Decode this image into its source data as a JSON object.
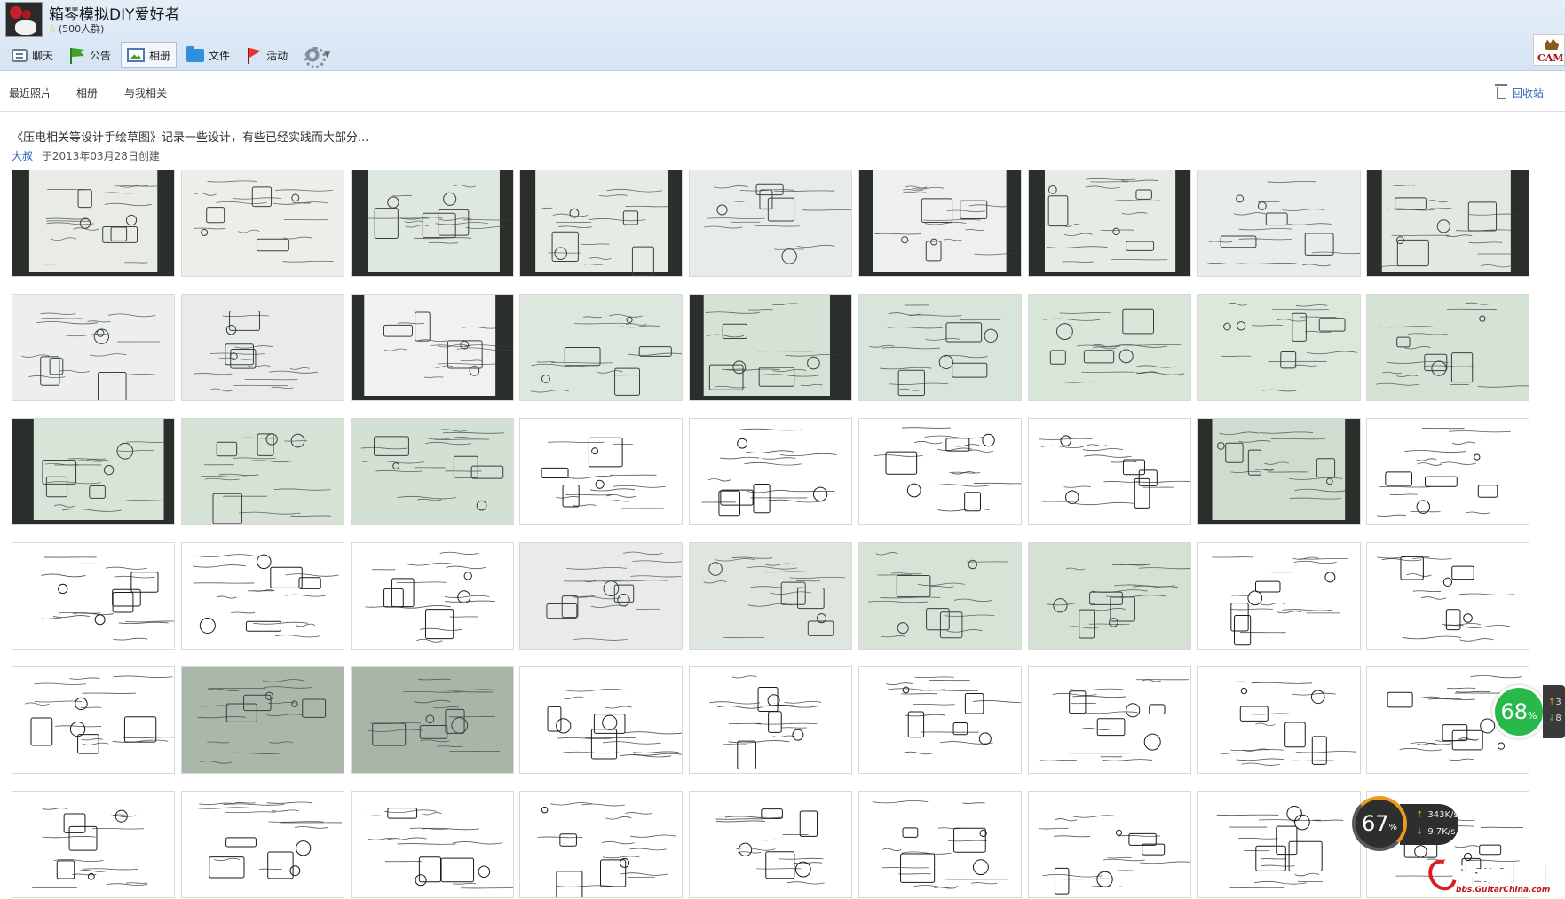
{
  "header": {
    "group_name": "箱琴模拟DIY爱好者",
    "member_count": "(500人群)",
    "toolbar": [
      {
        "id": "chat",
        "label": "聊天",
        "icon": "chat-icon"
      },
      {
        "id": "notice",
        "label": "公告",
        "icon": "flag-icon"
      },
      {
        "id": "album",
        "label": "相册",
        "icon": "album-icon",
        "active": true
      },
      {
        "id": "file",
        "label": "文件",
        "icon": "folder-icon"
      },
      {
        "id": "activity",
        "label": "活动",
        "icon": "red-flag-icon"
      }
    ],
    "brand_logo_text": "CAMI"
  },
  "subnav": {
    "tabs": [
      "最近照片",
      "相册",
      "与我相关"
    ],
    "recycle_bin": "回收站"
  },
  "album": {
    "title": "《压电相关等设计手绘草图》记录一些设计，有些已经实践而大部分...",
    "author": "大叔",
    "created": "于2013年03月28日创建"
  },
  "grid": {
    "rows": 6,
    "cols": 9
  },
  "overlays": {
    "speed_badge_value": "68",
    "speed_badge_unit": "%",
    "speed_tail_up": "3",
    "speed_tail_down": "8",
    "net_percent": "67",
    "net_percent_unit": "%",
    "upload_speed": "343K/s",
    "download_speed": "9.7K/s",
    "watermark_main": "吉他中国",
    "watermark_sub": "bbs.GuitarChina.com"
  },
  "colors": {
    "link": "#2e65b8",
    "header_bg": "#d6e4f3",
    "badge_green": "#29b84a"
  }
}
